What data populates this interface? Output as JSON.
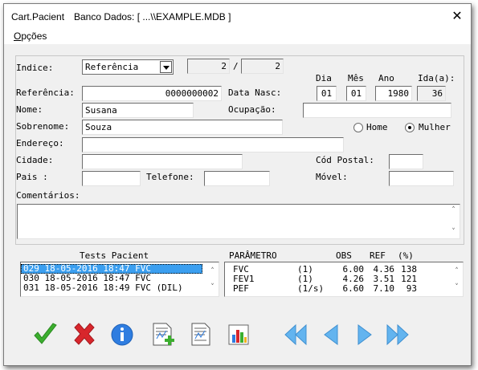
{
  "window": {
    "title": "Cart.Pacient",
    "db_label": "Banco Dados: [ ...\\\\EXAMPLE.MDB ]"
  },
  "menu": {
    "opcoes_first": "O",
    "opcoes_rest": "pções"
  },
  "form": {
    "indice_label": "Indice:",
    "indice_value": "Referência",
    "record_current": "2",
    "record_sep": "/",
    "record_total": "2",
    "referencia_label": "Referência:",
    "referencia_value": "0000000002",
    "data_nasc_label": "Data Nasc:",
    "dia_label": "Dia",
    "mes_label": "Mês",
    "ano_label": "Ano",
    "idade_label": "Ida(a):",
    "dia_value": "01",
    "mes_value": "01",
    "ano_value": "1980",
    "idade_value": "36",
    "nome_label": "Nome:",
    "nome_value": "Susana",
    "ocupacao_label": "Ocupação:",
    "ocupacao_value": "",
    "sobrenome_label": "Sobrenome:",
    "sobrenome_value": "Souza",
    "home_label": "Home",
    "mulher_label": "Mulher",
    "sex_selected": "Mulher",
    "endereco_label": "Endereço:",
    "endereco_value": "",
    "cidade_label": "Cidade:",
    "cidade_value": "",
    "cod_postal_label": "Cód Postal:",
    "cod_postal_value": "",
    "pais_label": "Pais :",
    "pais_value": "",
    "telefone_label": "Telefone:",
    "telefone_value": "",
    "movel_label": "Móvel:",
    "movel_value": "",
    "comentarios_label": "Comentários:",
    "comentarios_value": ""
  },
  "tests": {
    "header": "Tests Pacient",
    "items": [
      {
        "text": "029 18-05-2016 18:47 FVC",
        "selected": true
      },
      {
        "text": "030 18-05-2016 18:47 FVC",
        "selected": false
      },
      {
        "text": "031 18-05-2016 18:49 FVC (DIL)",
        "selected": false
      }
    ]
  },
  "params": {
    "headers": {
      "param": "PARÂMETRO",
      "obs": "OBS",
      "ref": "REF",
      "pct": "(%)"
    },
    "rows": [
      {
        "name": "FVC",
        "unit": "(1)",
        "obs": "6.00",
        "ref": "4.36",
        "pct": "138"
      },
      {
        "name": "FEV1",
        "unit": "(1)",
        "obs": "4.26",
        "ref": "3.51",
        "pct": "121"
      },
      {
        "name": "PEF",
        "unit": "(1/s)",
        "obs": "6.60",
        "ref": "7.10",
        "pct": "93"
      }
    ]
  },
  "toolbar": {
    "icons": [
      "check-icon",
      "delete-x-icon",
      "info-icon",
      "new-document-icon",
      "document-icon",
      "chart-icon",
      "first-record-icon",
      "previous-record-icon",
      "next-record-icon",
      "last-record-icon"
    ]
  },
  "colors": {
    "selection": "#3b9ff0",
    "check": "#3cae2f",
    "delete": "#d8262c",
    "info": "#2f7de0",
    "nav": "#63b4ef"
  }
}
